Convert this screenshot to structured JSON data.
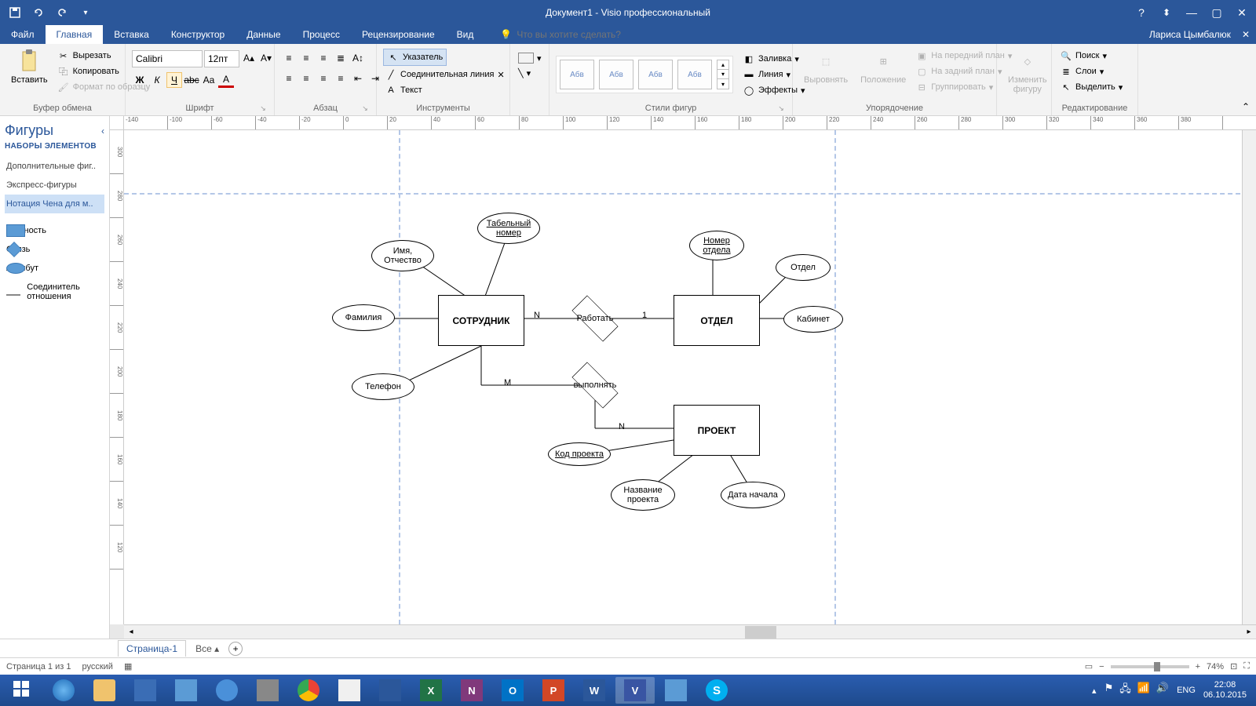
{
  "title": "Документ1 - Visio профессиональный",
  "user": "Лариса Цымбалюк",
  "tabs": {
    "file": "Файл",
    "home": "Главная",
    "insert": "Вставка",
    "design": "Конструктор",
    "data": "Данные",
    "process": "Процесс",
    "review": "Рецензирование",
    "view": "Вид"
  },
  "tellme": "Что вы хотите сделать?",
  "ribbon": {
    "clipboard": {
      "label": "Буфер обмена",
      "paste": "Вставить",
      "cut": "Вырезать",
      "copy": "Копировать",
      "format": "Формат по образцу"
    },
    "font": {
      "label": "Шрифт",
      "name": "Calibri",
      "size": "12пт"
    },
    "para": {
      "label": "Абзац"
    },
    "tools": {
      "label": "Инструменты",
      "pointer": "Указатель",
      "connector": "Соединительная линия",
      "text": "Текст"
    },
    "styles": {
      "label": "Стили фигур",
      "sample": "Абв"
    },
    "sstyles": {
      "fill": "Заливка",
      "line": "Линия",
      "effects": "Эффекты"
    },
    "arrange": {
      "label": "Упорядочение",
      "align": "Выровнять",
      "position": "Положение",
      "front": "На передний план",
      "back": "На задний план",
      "group": "Группировать"
    },
    "change": {
      "label": "Изменить фигуру"
    },
    "edit": {
      "label": "Редактирование",
      "find": "Поиск",
      "layers": "Слои",
      "select": "Выделить"
    }
  },
  "shapes": {
    "title": "Фигуры",
    "sets": "НАБОРЫ ЭЛЕМЕНТОВ",
    "links": [
      "Дополнительные фиг..",
      "Экспресс-фигуры",
      "Нотация Чена для м.."
    ],
    "items": {
      "entity": "Сущность",
      "relation": "Связь",
      "attribute": "Атрибут",
      "connector": "Соединитель отношения"
    }
  },
  "diagram": {
    "e1": "СОТРУДНИК",
    "e2": "ОТДЕЛ",
    "e3": "ПРОЕКТ",
    "r1": "Работать",
    "r2": "выполнять",
    "a_tab": "Табельный номер",
    "a_name": "Имя, Отчество",
    "a_fam": "Фамилия",
    "a_tel": "Телефон",
    "a_depno": "Номер отдела",
    "a_dep": "Отдел",
    "a_cab": "Кабинет",
    "a_code": "Код проекта",
    "a_pname": "Название проекта",
    "a_date": "Дата начала",
    "cN": "N",
    "c1": "1",
    "cM": "M"
  },
  "page": {
    "tab": "Страница-1",
    "all": "Все"
  },
  "status": {
    "page": "Страница 1 из 1",
    "lang": "русский",
    "zoom": "74%"
  },
  "tray": {
    "lang": "ENG",
    "time": "22:08",
    "date": "06.10.2015"
  }
}
